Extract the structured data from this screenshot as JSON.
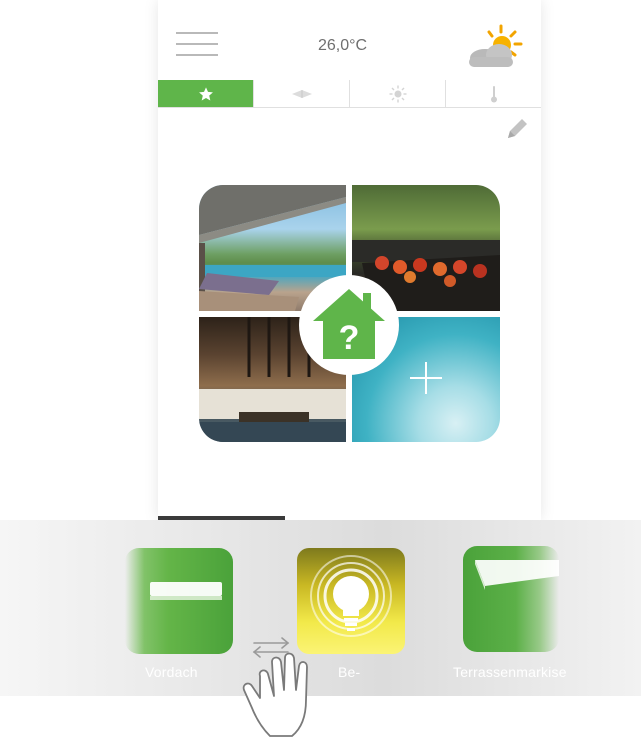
{
  "header": {
    "temperature": "26,0°C",
    "menu_icon": "hamburger-menu-icon",
    "weather_icon": "partly-cloudy-icon"
  },
  "tabs": [
    {
      "icon": "star-icon",
      "active": true
    },
    {
      "icon": "awning-icon",
      "active": false
    },
    {
      "icon": "sun-icon",
      "active": false
    },
    {
      "icon": "thermometer-icon",
      "active": false
    }
  ],
  "scenes": {
    "center_icon": "house-question-icon",
    "center_symbol": "?",
    "add_icon": "plus-icon"
  },
  "apps": [
    {
      "label": "Vordach",
      "icon": "canopy-icon"
    },
    {
      "label": "Be-",
      "icon": "light-bulb-icon"
    },
    {
      "label": "Terrassenmarkise",
      "icon": "awning-icon"
    }
  ],
  "colors": {
    "accent_green": "#5fb54a",
    "light_yellow": "#f2e94a",
    "strip_gray": "#e2e2e2"
  }
}
